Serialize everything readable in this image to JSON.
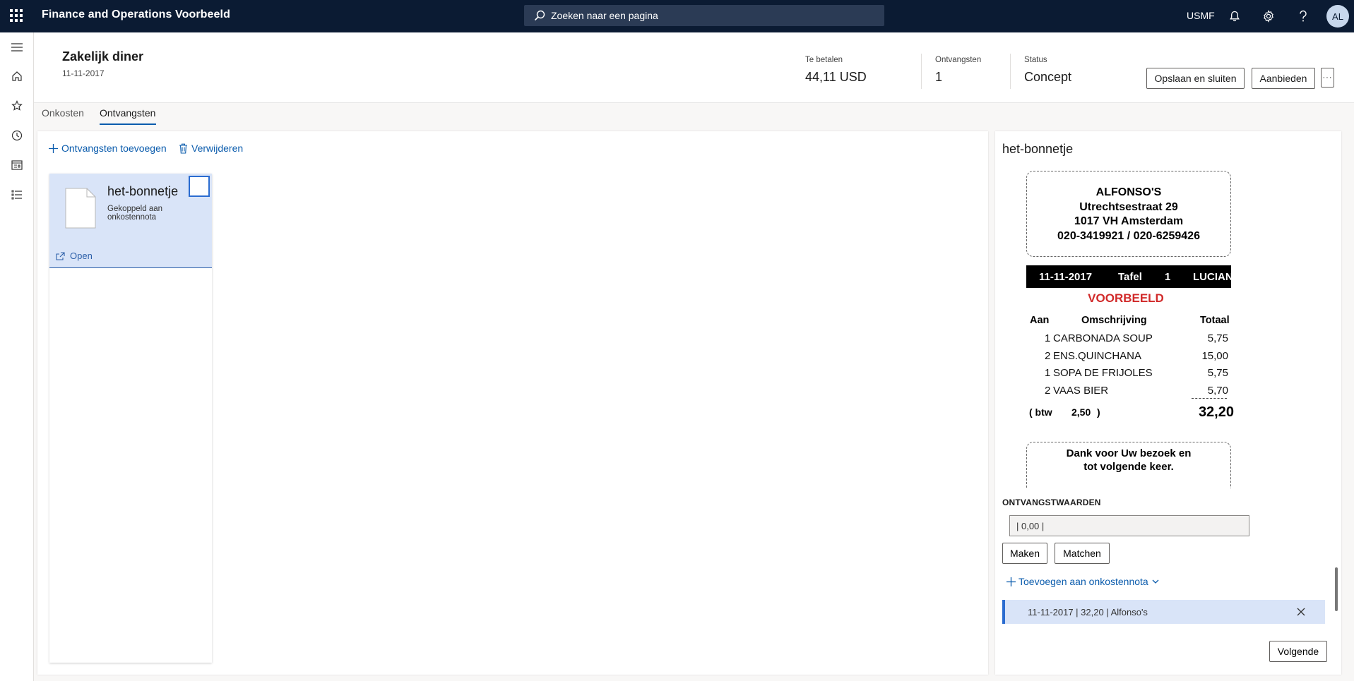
{
  "app": {
    "title": "Finance and Operations Voorbeeld",
    "search_placeholder": "Zoeken naar een pagina",
    "company": "USMF",
    "user_initials": "AL"
  },
  "header": {
    "title": "Zakelijk diner",
    "date": "11-11-2017",
    "stats": [
      {
        "label": "Te betalen",
        "value": "44,11 USD"
      },
      {
        "label": "Ontvangsten",
        "value": "1"
      },
      {
        "label": "Status",
        "value": "Concept"
      }
    ],
    "save_close_label": "Opslaan en sluiten",
    "submit_label": "Aanbieden",
    "more_label": "···"
  },
  "tabs": [
    {
      "label": "Onkosten",
      "active": false
    },
    {
      "label": "Ontvangsten",
      "active": true
    }
  ],
  "actions": {
    "add_receipts": "Ontvangsten toevoegen",
    "delete": "Verwijderen"
  },
  "card": {
    "title": "het-bonnetje",
    "subtitle": "Gekoppeld aan onkostennota",
    "open_label": "Open"
  },
  "details": {
    "title": "het-bonnetje",
    "receipt": {
      "header_lines": [
        "ALFONSO'S",
        "Utrechtsestraat 29",
        "1017 VH Amsterdam",
        "020-3419921 / 020-6259426"
      ],
      "bar": {
        "date": "11-11-2017",
        "table_label": "Tafel",
        "table_no": "1",
        "waiter": "LUCIANA"
      },
      "watermark": "VOORBEELD",
      "columns": {
        "qty": "Aan",
        "desc": "Omschrijving",
        "total": "Totaal"
      },
      "items": [
        {
          "qty": "1",
          "desc": "CARBONADA  SOUP",
          "amount": "5,75"
        },
        {
          "qty": "2",
          "desc": "ENS.QUINCHANA",
          "amount": "15,00"
        },
        {
          "qty": "1",
          "desc": "SOPA DE FRIJOLES",
          "amount": "5,75"
        },
        {
          "qty": "2",
          "desc": "VAAS BIER",
          "amount": "5,70"
        }
      ],
      "btw_open": "( btw",
      "btw_value": "2,50",
      "btw_close": ")",
      "total": "32,20",
      "footer_lines": [
        "Dank voor Uw bezoek en",
        "tot volgende keer."
      ]
    },
    "values_label": "ONTVANGSTWAARDEN",
    "values_input": "| 0,00 |",
    "make_label": "Maken",
    "match_label": "Matchen",
    "add_to_report": "Toevoegen aan onkostennota",
    "match_row": "11-11-2017 | 32,20 | Alfonso's",
    "next_label": "Volgende"
  }
}
